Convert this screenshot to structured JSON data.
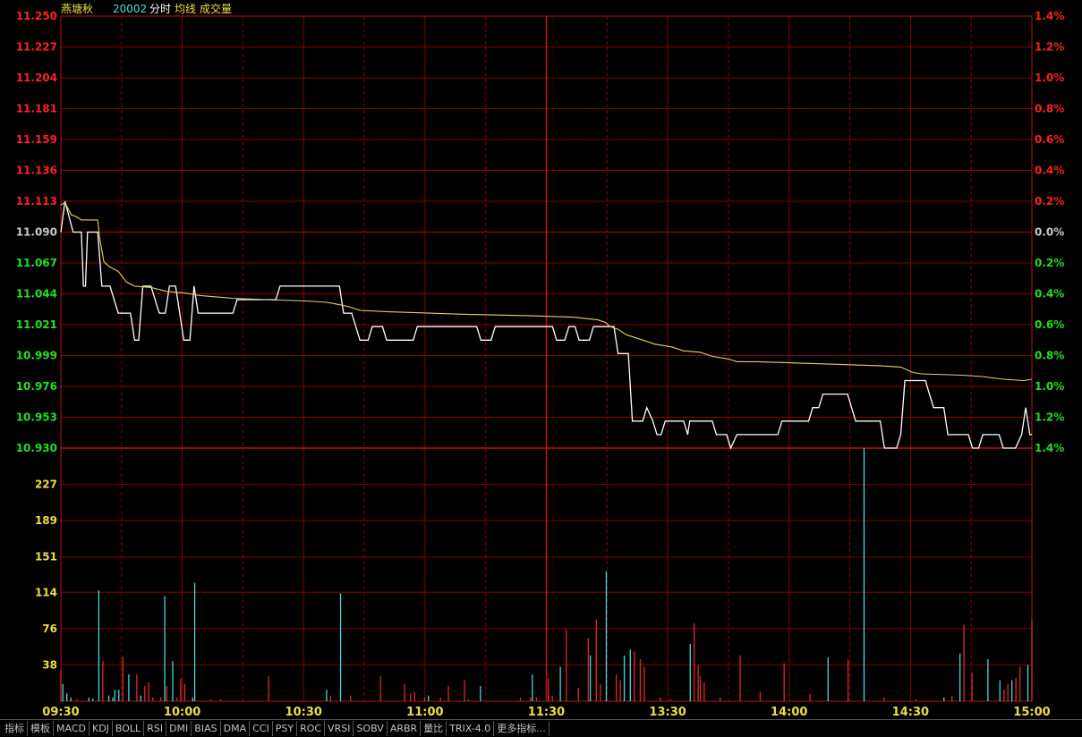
{
  "header": {
    "stock_name": "燕塘秋",
    "code": "20002",
    "labels": [
      "分时",
      "均线",
      "成交量"
    ]
  },
  "colors": {
    "grid": "#8b0000",
    "up": "#ff2020",
    "down": "#20e020",
    "flat": "#c8c8c8",
    "price_line": "#ffffff",
    "avg_line": "#e8d060",
    "vol_up": "#e02828",
    "vol_down": "#40d8e0",
    "vol_axis": "#e8e040",
    "time_label": "#e8e040",
    "code_color": "#40e0e0",
    "title_color": "#e8e040"
  },
  "chart_data": {
    "type": "line",
    "prev_close": 11.09,
    "price_ticks": [
      "11.250",
      "11.227",
      "11.204",
      "11.181",
      "11.159",
      "11.136",
      "11.113",
      "11.090",
      "11.067",
      "11.044",
      "11.021",
      "10.999",
      "10.976",
      "10.953",
      "10.930"
    ],
    "pct_ticks": [
      "1.4%",
      "1.2%",
      "1.0%",
      "0.8%",
      "0.6%",
      "0.4%",
      "0.2%",
      "0.0%",
      "0.2%",
      "0.4%",
      "0.6%",
      "0.8%",
      "1.0%",
      "1.2%",
      "1.4%"
    ],
    "ylim": [
      10.93,
      11.25
    ],
    "time_ticks": [
      "09:30",
      "10:00",
      "10:30",
      "11:00",
      "11:30",
      "13:30",
      "14:00",
      "14:30",
      "15:00"
    ],
    "volume_ticks": [
      "227",
      "189",
      "151",
      "114",
      "76",
      "38"
    ],
    "volume_ylim": [
      0,
      265
    ],
    "series": [
      {
        "name": "分时",
        "points": [
          [
            0,
            11.09
          ],
          [
            2,
            11.113
          ],
          [
            6,
            11.09
          ],
          [
            10,
            11.09
          ],
          [
            11,
            11.05
          ],
          [
            12,
            11.05
          ],
          [
            13,
            11.09
          ],
          [
            18,
            11.09
          ],
          [
            20,
            11.05
          ],
          [
            24,
            11.05
          ],
          [
            28,
            11.03
          ],
          [
            34,
            11.03
          ],
          [
            36,
            11.01
          ],
          [
            38,
            11.01
          ],
          [
            40,
            11.05
          ],
          [
            44,
            11.05
          ],
          [
            48,
            11.03
          ],
          [
            51,
            11.03
          ],
          [
            53,
            11.05
          ],
          [
            56,
            11.05
          ],
          [
            58,
            11.03
          ],
          [
            60,
            11.01
          ],
          [
            63,
            11.01
          ],
          [
            65,
            11.05
          ],
          [
            67,
            11.03
          ],
          [
            84,
            11.03
          ],
          [
            86,
            11.04
          ],
          [
            105,
            11.04
          ],
          [
            107,
            11.05
          ],
          [
            136,
            11.05
          ],
          [
            138,
            11.03
          ],
          [
            142,
            11.03
          ],
          [
            146,
            11.01
          ],
          [
            150,
            11.01
          ],
          [
            152,
            11.02
          ],
          [
            157,
            11.02
          ],
          [
            159,
            11.01
          ],
          [
            172,
            11.01
          ],
          [
            174,
            11.02
          ],
          [
            203,
            11.02
          ],
          [
            205,
            11.01
          ],
          [
            210,
            11.01
          ],
          [
            212,
            11.02
          ],
          [
            240,
            11.02
          ],
          [
            242,
            11.01
          ],
          [
            246,
            11.01
          ],
          [
            248,
            11.02
          ],
          [
            251,
            11.02
          ],
          [
            253,
            11.01
          ],
          [
            258,
            11.01
          ],
          [
            260,
            11.02
          ],
          [
            270,
            11.02
          ],
          [
            272,
            11.0
          ],
          [
            277,
            11.0
          ],
          [
            279,
            10.95
          ],
          [
            284,
            10.95
          ],
          [
            286,
            10.96
          ],
          [
            289,
            10.95
          ],
          [
            291,
            10.94
          ],
          [
            293,
            10.94
          ],
          [
            295,
            10.95
          ],
          [
            304,
            10.95
          ],
          [
            306,
            10.94
          ],
          [
            307,
            10.95
          ],
          [
            318,
            10.95
          ],
          [
            320,
            10.94
          ],
          [
            325,
            10.94
          ],
          [
            327,
            10.93
          ],
          [
            330,
            10.94
          ],
          [
            350,
            10.94
          ],
          [
            352,
            10.95
          ],
          [
            365,
            10.95
          ],
          [
            367,
            10.96
          ],
          [
            370,
            10.96
          ],
          [
            372,
            10.97
          ],
          [
            384,
            10.97
          ],
          [
            388,
            10.95
          ],
          [
            400,
            10.95
          ],
          [
            402,
            10.93
          ],
          [
            408,
            10.93
          ],
          [
            410,
            10.94
          ],
          [
            412,
            10.98
          ],
          [
            422,
            10.98
          ],
          [
            426,
            10.96
          ],
          [
            431,
            10.96
          ],
          [
            433,
            10.94
          ],
          [
            443,
            10.94
          ],
          [
            445,
            10.93
          ],
          [
            448,
            10.93
          ],
          [
            450,
            10.94
          ],
          [
            458,
            10.94
          ],
          [
            460,
            10.93
          ],
          [
            466,
            10.93
          ],
          [
            469,
            10.94
          ],
          [
            471,
            10.96
          ],
          [
            473,
            10.94
          ],
          [
            474,
            10.94
          ]
        ]
      },
      {
        "name": "均线",
        "points": [
          [
            0,
            11.11
          ],
          [
            2,
            11.112
          ],
          [
            5,
            11.103
          ],
          [
            8,
            11.101
          ],
          [
            10,
            11.099
          ],
          [
            18,
            11.099
          ],
          [
            19,
            11.085
          ],
          [
            21,
            11.068
          ],
          [
            24,
            11.064
          ],
          [
            28,
            11.061
          ],
          [
            32,
            11.053
          ],
          [
            36,
            11.05
          ],
          [
            44,
            11.049
          ],
          [
            52,
            11.046
          ],
          [
            60,
            11.045
          ],
          [
            68,
            11.043
          ],
          [
            84,
            11.041
          ],
          [
            100,
            11.04
          ],
          [
            120,
            11.039
          ],
          [
            130,
            11.038
          ],
          [
            140,
            11.035
          ],
          [
            146,
            11.032
          ],
          [
            160,
            11.031
          ],
          [
            180,
            11.03
          ],
          [
            200,
            11.029
          ],
          [
            230,
            11.028
          ],
          [
            250,
            11.027
          ],
          [
            262,
            11.025
          ],
          [
            266,
            11.023
          ],
          [
            268,
            11.02
          ],
          [
            272,
            11.018
          ],
          [
            276,
            11.014
          ],
          [
            282,
            11.011
          ],
          [
            290,
            11.007
          ],
          [
            298,
            11.005
          ],
          [
            304,
            11.002
          ],
          [
            312,
            11.001
          ],
          [
            318,
            10.998
          ],
          [
            326,
            10.996
          ],
          [
            330,
            10.994
          ],
          [
            340,
            10.994
          ],
          [
            360,
            10.993
          ],
          [
            380,
            10.992
          ],
          [
            400,
            10.991
          ],
          [
            410,
            10.99
          ],
          [
            416,
            10.986
          ],
          [
            420,
            10.985
          ],
          [
            440,
            10.984
          ],
          [
            450,
            10.983
          ],
          [
            460,
            10.981
          ],
          [
            470,
            10.98
          ],
          [
            474,
            10.981
          ]
        ]
      }
    ],
    "volume": [
      [
        0,
        32,
        "u"
      ],
      [
        1,
        18,
        "d"
      ],
      [
        3,
        8,
        "d"
      ],
      [
        5,
        4,
        "d"
      ],
      [
        8,
        2,
        "u"
      ],
      [
        14,
        4,
        "d"
      ],
      [
        16,
        3,
        "d"
      ],
      [
        19,
        116,
        "d"
      ],
      [
        21,
        42,
        "u"
      ],
      [
        24,
        6,
        "d"
      ],
      [
        26,
        4,
        "d"
      ],
      [
        27,
        12,
        "d"
      ],
      [
        29,
        12,
        "d"
      ],
      [
        31,
        46,
        "u"
      ],
      [
        34,
        28,
        "d"
      ],
      [
        38,
        28,
        "u"
      ],
      [
        40,
        6,
        "d"
      ],
      [
        42,
        16,
        "u"
      ],
      [
        44,
        20,
        "u"
      ],
      [
        46,
        4,
        "u"
      ],
      [
        50,
        4,
        "u"
      ],
      [
        52,
        110,
        "d"
      ],
      [
        53,
        16,
        "u"
      ],
      [
        56,
        42,
        "d"
      ],
      [
        58,
        4,
        "u"
      ],
      [
        60,
        24,
        "u"
      ],
      [
        62,
        18,
        "u"
      ],
      [
        66,
        4,
        "d"
      ],
      [
        67,
        124,
        "d"
      ],
      [
        75,
        2,
        "u"
      ],
      [
        80,
        2,
        "u"
      ],
      [
        104,
        26,
        "u"
      ],
      [
        133,
        12,
        "d"
      ],
      [
        135,
        6,
        "u"
      ],
      [
        140,
        113,
        "d"
      ],
      [
        145,
        6,
        "u"
      ],
      [
        160,
        26,
        "u"
      ],
      [
        172,
        18,
        "u"
      ],
      [
        175,
        8,
        "u"
      ],
      [
        177,
        10,
        "u"
      ],
      [
        182,
        4,
        "u"
      ],
      [
        184,
        6,
        "d"
      ],
      [
        190,
        4,
        "u"
      ],
      [
        194,
        16,
        "u"
      ],
      [
        202,
        22,
        "u"
      ],
      [
        204,
        2,
        "u"
      ],
      [
        210,
        16,
        "d"
      ],
      [
        230,
        4,
        "u"
      ],
      [
        235,
        4,
        "u"
      ],
      [
        236,
        28,
        "d"
      ],
      [
        238,
        4,
        "u"
      ],
      [
        244,
        24,
        "u"
      ],
      [
        246,
        6,
        "u"
      ],
      [
        250,
        36,
        "d"
      ],
      [
        253,
        75,
        "u"
      ],
      [
        259,
        14,
        "u"
      ],
      [
        264,
        66,
        "u"
      ],
      [
        265,
        48,
        "d"
      ],
      [
        268,
        86,
        "u"
      ],
      [
        270,
        18,
        "u"
      ],
      [
        273,
        136,
        "d"
      ],
      [
        278,
        28,
        "u"
      ],
      [
        280,
        22,
        "u"
      ],
      [
        282,
        48,
        "d"
      ],
      [
        285,
        54,
        "d"
      ],
      [
        287,
        52,
        "u"
      ],
      [
        290,
        44,
        "u"
      ],
      [
        292,
        36,
        "u"
      ],
      [
        300,
        4,
        "u"
      ],
      [
        305,
        2,
        "u"
      ],
      [
        315,
        60,
        "d"
      ],
      [
        317,
        82,
        "u"
      ],
      [
        319,
        38,
        "u"
      ],
      [
        320,
        26,
        "u"
      ],
      [
        322,
        20,
        "u"
      ],
      [
        330,
        4,
        "u"
      ],
      [
        340,
        48,
        "u"
      ],
      [
        350,
        10,
        "u"
      ],
      [
        362,
        40,
        "u"
      ],
      [
        375,
        8,
        "u"
      ],
      [
        384,
        46,
        "d"
      ],
      [
        394,
        44,
        "u"
      ],
      [
        402,
        306,
        "d"
      ],
      [
        412,
        4,
        "u"
      ],
      [
        428,
        2,
        "u"
      ],
      [
        442,
        4,
        "d"
      ],
      [
        446,
        6,
        "u"
      ],
      [
        450,
        50,
        "d"
      ],
      [
        452,
        80,
        "u"
      ],
      [
        456,
        30,
        "u"
      ],
      [
        464,
        44,
        "d"
      ],
      [
        470,
        22,
        "d"
      ],
      [
        472,
        12,
        "u"
      ],
      [
        474,
        18,
        "u"
      ],
      [
        476,
        22,
        "d"
      ],
      [
        478,
        24,
        "u"
      ],
      [
        480,
        36,
        "u"
      ],
      [
        484,
        38,
        "d"
      ],
      [
        486,
        86,
        "u"
      ]
    ]
  },
  "toolbar": {
    "tabs": [
      "指标",
      "模板",
      "MACD",
      "KDJ",
      "BOLL",
      "RSI",
      "DMI",
      "BIAS",
      "DMA",
      "CCI",
      "PSY",
      "ROC",
      "VRSI",
      "SOBV",
      "ARBR",
      "量比",
      "TRIX-4.0",
      "更多指标..."
    ]
  }
}
